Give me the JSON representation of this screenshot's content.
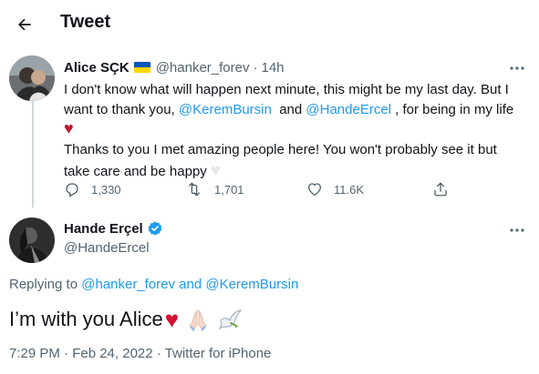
{
  "header": {
    "title": "Tweet"
  },
  "tweet1": {
    "author_name": "Alice SÇK",
    "handle": "@hanker_forev",
    "separator": "·",
    "time": "14h",
    "line1": "I don't know what will happen next minute, this might be my last day. But I",
    "line2_prefix": "want to thank you, ",
    "mention1": "@KeremBursin",
    "line2_mid": "  and ",
    "mention2": "@HandeErcel",
    "line2_suffix": " , for being in my life",
    "line4": "Thanks to you I met amazing people here! You won't probably see it but",
    "line5": "take care and be happy",
    "stats": {
      "replies": "1,330",
      "retweets": "1,701",
      "likes": "11.6K"
    }
  },
  "tweet2": {
    "author_name": "Hande Erçel",
    "handle": "@HandeErcel",
    "replying_prefix": "Replying to ",
    "replying_users": "@hanker_forev and @KeremBursin",
    "text": "I’m with you Alice",
    "meta": "7:29 PM · Feb 24, 2022 · Twitter for iPhone"
  },
  "icons": {
    "back": "arrow-left-icon",
    "more": "more-horizontal-icon",
    "reply": "reply-bubble-icon",
    "retweet": "retweet-icon",
    "like": "heart-outline-icon",
    "share": "share-icon",
    "verified": "verified-badge-icon",
    "flag": "ukraine-flag-icon"
  },
  "colors": {
    "accent": "#1d9bf0",
    "muted": "#536471",
    "text": "#0f1419"
  }
}
